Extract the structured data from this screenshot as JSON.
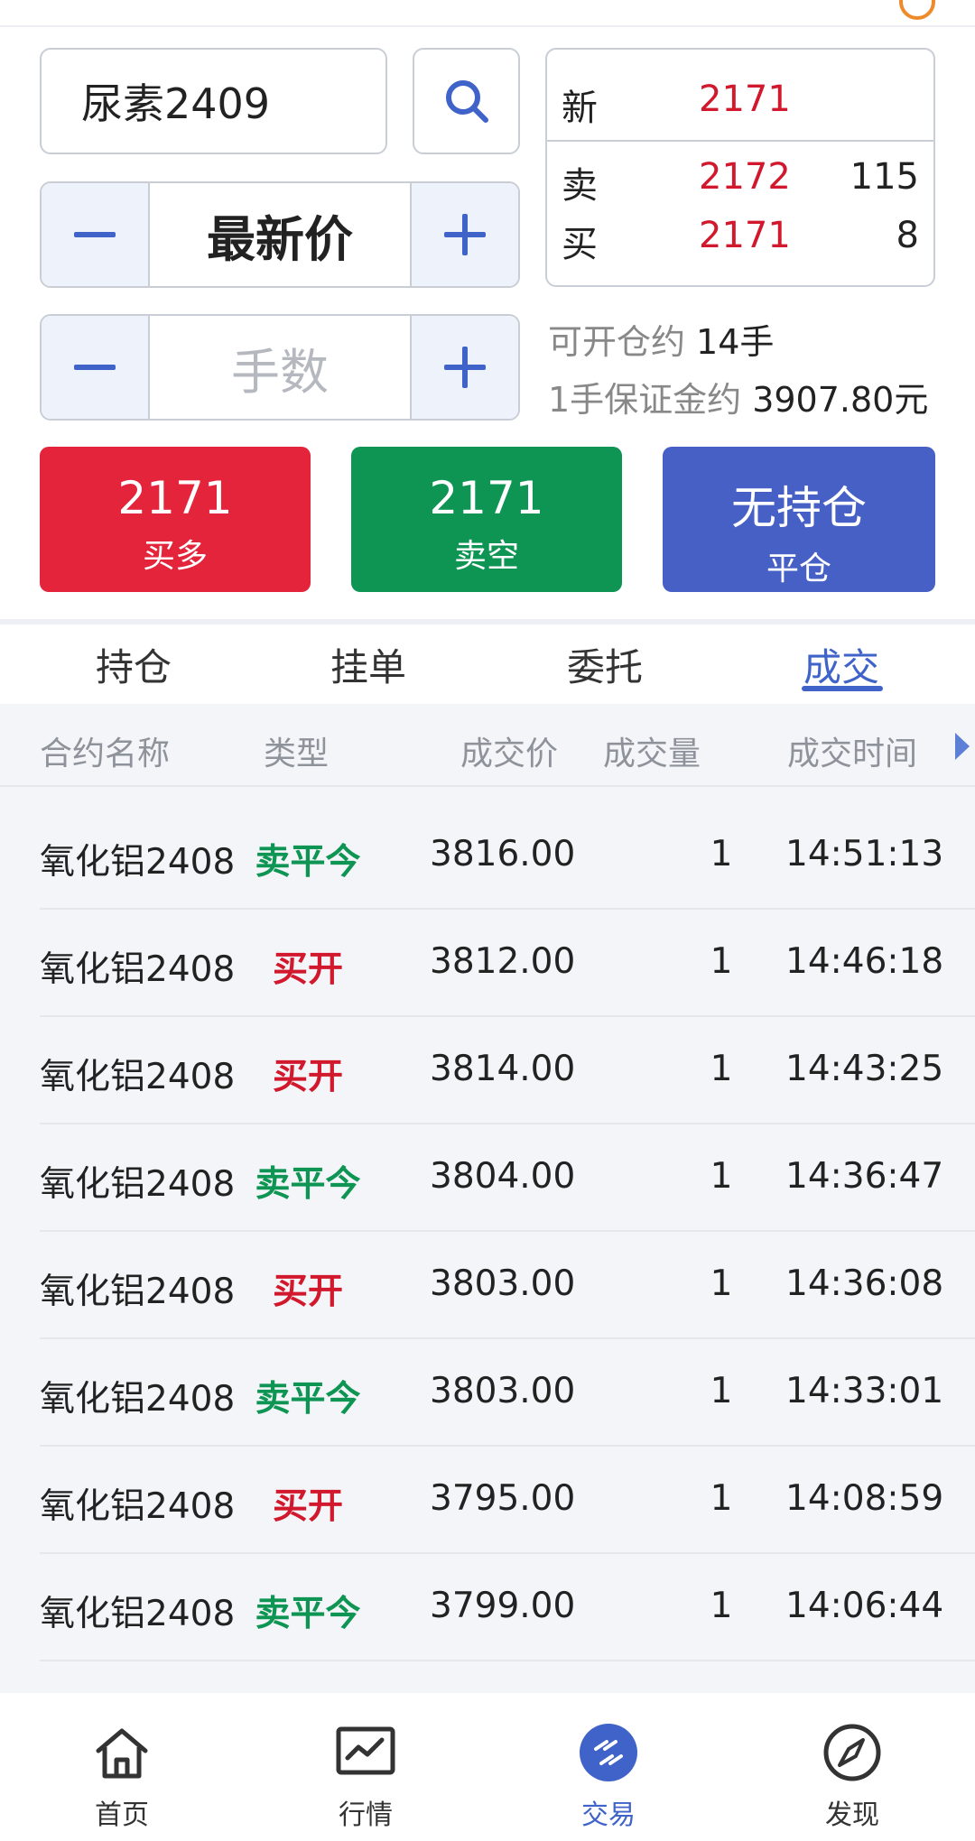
{
  "contract_search": {
    "value": "尿素2409"
  },
  "price_stepper": {
    "value": "最新价"
  },
  "lots_stepper": {
    "placeholder": "手数"
  },
  "quote_panel": {
    "last_label": "新",
    "last_price": "2171",
    "ask_label": "卖",
    "ask_price": "2172",
    "ask_volume": "115",
    "bid_label": "买",
    "bid_price": "2171",
    "bid_volume": "8"
  },
  "account_info": {
    "openable_label": "可开仓约",
    "openable_value": "14手",
    "margin_label": "1手保证金约",
    "margin_value": "3907.80元"
  },
  "actions": {
    "buy_price": "2171",
    "buy_label": "买多",
    "sell_price": "2171",
    "sell_label": "卖空",
    "close_title": "无持仓",
    "close_label": "平仓"
  },
  "tabs": [
    {
      "label": "持仓",
      "active": false
    },
    {
      "label": "挂单",
      "active": false
    },
    {
      "label": "委托",
      "active": false
    },
    {
      "label": "成交",
      "active": true
    }
  ],
  "table": {
    "headers": [
      "合约名称",
      "类型",
      "成交价",
      "成交量",
      "成交时间"
    ],
    "rows": [
      {
        "name": "氧化铝2408",
        "type": "卖平今",
        "price": "3816.00",
        "qty": "1",
        "time": "14:51:13"
      },
      {
        "name": "氧化铝2408",
        "type": "买开",
        "price": "3812.00",
        "qty": "1",
        "time": "14:46:18"
      },
      {
        "name": "氧化铝2408",
        "type": "买开",
        "price": "3814.00",
        "qty": "1",
        "time": "14:43:25"
      },
      {
        "name": "氧化铝2408",
        "type": "卖平今",
        "price": "3804.00",
        "qty": "1",
        "time": "14:36:47"
      },
      {
        "name": "氧化铝2408",
        "type": "买开",
        "price": "3803.00",
        "qty": "1",
        "time": "14:36:08"
      },
      {
        "name": "氧化铝2408",
        "type": "卖平今",
        "price": "3803.00",
        "qty": "1",
        "time": "14:33:01"
      },
      {
        "name": "氧化铝2408",
        "type": "买开",
        "price": "3795.00",
        "qty": "1",
        "time": "14:08:59"
      },
      {
        "name": "氧化铝2408",
        "type": "卖平今",
        "price": "3799.00",
        "qty": "1",
        "time": "14:06:44"
      }
    ]
  },
  "bottom_nav": [
    {
      "label": "首页",
      "icon": "home-icon",
      "active": false
    },
    {
      "label": "行情",
      "icon": "chart-icon",
      "active": false
    },
    {
      "label": "交易",
      "icon": "trade-icon",
      "active": true
    },
    {
      "label": "发现",
      "icon": "compass-icon",
      "active": false
    }
  ],
  "colors": {
    "accent": "#3f63c8",
    "buy": "#e3243b",
    "sell": "#0e9553",
    "close": "#4660c6",
    "price_red": "#d2182d"
  }
}
